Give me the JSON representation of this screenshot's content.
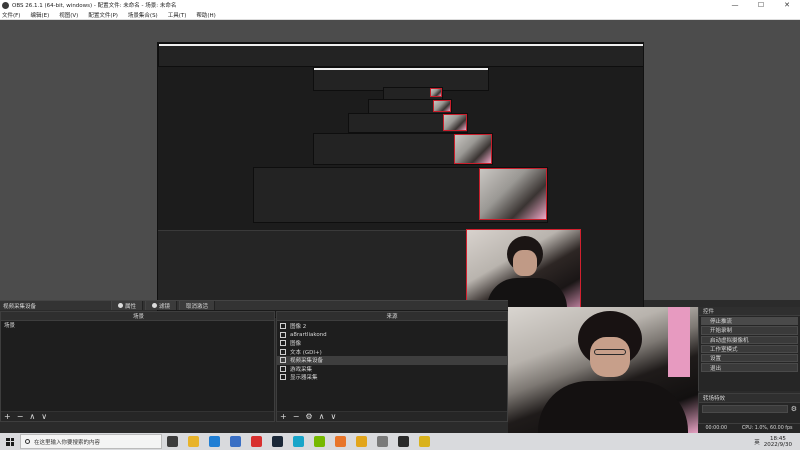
{
  "window": {
    "title": "OBS 26.1.1 (64-bit, windows) - 配置文件: 未命名 - 场景: 未命名",
    "controls": [
      "—",
      "☐",
      "✕"
    ]
  },
  "menu": [
    "文件(F)",
    "编辑(E)",
    "视图(V)",
    "配置文件(P)",
    "场景集合(S)",
    "工具(T)",
    "帮助(H)"
  ],
  "source_bar": {
    "selected_source": "视频采集设备",
    "properties": "属性",
    "filters": "滤镜",
    "deactivate": "取消激活"
  },
  "scenes": {
    "header": "场景",
    "items": [
      "场景"
    ]
  },
  "sources": {
    "header": "来源",
    "items": [
      {
        "name": "图像 2",
        "selected": false
      },
      {
        "name": "a8rartliakond",
        "selected": false
      },
      {
        "name": "图像",
        "selected": false
      },
      {
        "name": "文本 (GDI+)",
        "selected": false
      },
      {
        "name": "视频采集设备",
        "selected": true
      },
      {
        "name": "游戏采集",
        "selected": false
      },
      {
        "name": "显示器采集",
        "selected": false
      }
    ]
  },
  "toolbar_glyphs": [
    "+",
    "−",
    "∧",
    "∨"
  ],
  "sources_toolbar_glyphs": [
    "+",
    "−",
    "⚙",
    "∧",
    "∨"
  ],
  "controls": {
    "header": "控件",
    "buttons": [
      {
        "label": "停止推流",
        "active": true
      },
      {
        "label": "开始录制",
        "active": false
      },
      {
        "label": "启动虚拟摄像机",
        "active": false
      },
      {
        "label": "工作室模式",
        "active": false
      },
      {
        "label": "设置",
        "active": false
      },
      {
        "label": "退出",
        "active": false
      }
    ]
  },
  "transitions": {
    "header": "转场特效"
  },
  "status": {
    "live_time": "00:00:00",
    "cpu": "CPU: 1.0%, 60.00 fps"
  },
  "taskbar": {
    "search_placeholder": "在这里输入你要搜索的内容",
    "lang": "英",
    "time": "18:45",
    "date": "2022/9/30",
    "icons": [
      {
        "name": "task-view",
        "color": "#3c3c3c"
      },
      {
        "name": "file-explorer",
        "color": "#e8b32a"
      },
      {
        "name": "edge",
        "color": "#1f7ed4"
      },
      {
        "name": "store",
        "color": "#3a6fc4"
      },
      {
        "name": "weibo",
        "color": "#d8302f"
      },
      {
        "name": "steam",
        "color": "#1b2838"
      },
      {
        "name": "app-cyan",
        "color": "#18a5c9"
      },
      {
        "name": "nvidia",
        "color": "#76b900"
      },
      {
        "name": "app-orange",
        "color": "#e8752a"
      },
      {
        "name": "chrome",
        "color": "#e2a51b"
      },
      {
        "name": "app-gray",
        "color": "#7a7a7a"
      },
      {
        "name": "obs",
        "color": "#2a2a2a"
      },
      {
        "name": "app-yellow",
        "color": "#d9b21c"
      }
    ]
  },
  "colors": {
    "preview_bg": "#4c4c4c",
    "panel_bg": "#1e1e1e",
    "selection_red": "#d1202e"
  }
}
